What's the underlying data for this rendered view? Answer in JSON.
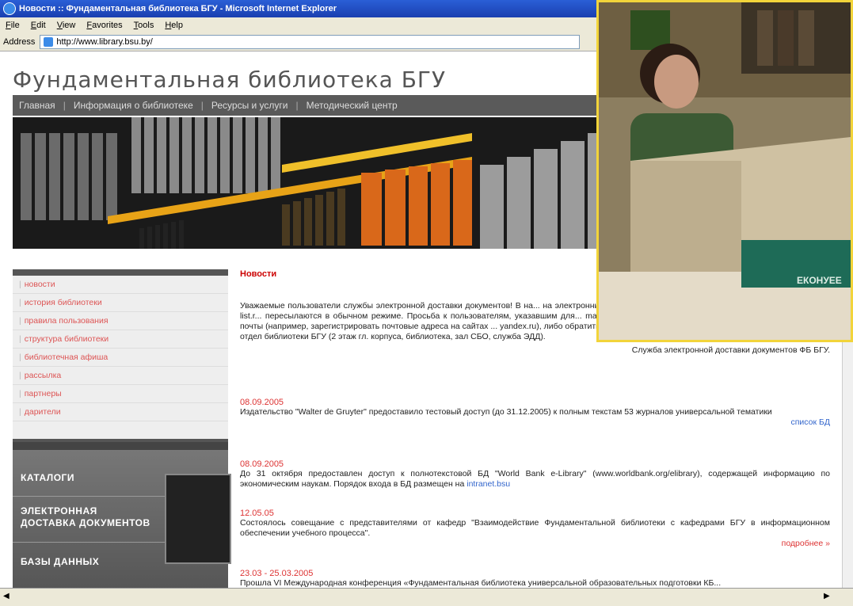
{
  "window": {
    "title": "Новости :: Фундаментальная библиотека БГУ - Microsoft Internet Explorer"
  },
  "menu": [
    "File",
    "Edit",
    "View",
    "Favorites",
    "Tools",
    "Help"
  ],
  "address": {
    "label": "Address",
    "url": "http://www.library.bsu.by/"
  },
  "site": {
    "title": "Фундаментальная библиотека БГУ",
    "nav": [
      "Главная",
      "Информация о библиотеке",
      "Ресурсы и услуги",
      "Методический центр"
    ]
  },
  "sidebar": {
    "items": [
      "новости",
      "история библиотеки",
      "правила пользования",
      "структура библиотеки",
      "библиотечная афиша",
      "рассылка",
      "партнеры",
      "дарители"
    ]
  },
  "promo": {
    "catalogs": "КАТАЛОГИ",
    "edd_line1": "ЭЛЕКТРОННАЯ",
    "edd_line2": "ДОСТАВКА ДОКУМЕНТОВ",
    "databases": "БАЗЫ ДАННЫХ"
  },
  "news": {
    "heading": "Новости",
    "intro": "Уважаемые пользователи службы электронной доставки документов! В на... на электронные адреса почтового сервера mail.ru (mail.ru; inbox.ru; bk.ru; list.r... пересылаются в обычном режиме. Просьба к пользователям, указавшим для... mail.ru , сообщить в службу ЭДД другие адреса электронной почты (например, зарегистрировать почтовые адреса на сайтах ... yandex.ru), либо обратиться для получения заказов в справочно-библиографический отдел библиотеки БГУ (2 этаж гл. корпуса, библиотека, зал СБО, служба ЭДД).",
    "signature": "Служба электронной доставки документов ФБ БГУ.",
    "items": [
      {
        "date": "08.09.2005",
        "text": "Издательство \"Walter de Gruyter\" предоставило тестовый доступ (до 31.12.2005) к полным текстам 53 журналов универсальной тематики",
        "link": "список БД"
      },
      {
        "date": "08.09.2005",
        "text": "До 31 октября предоставлен доступ к полнотекстовой БД \"World Bank e-Library\" (www.worldbank.org/elibrary), содержащей информацию по экономическим наукам. Порядок входа в БД размещен на",
        "inline_link": "intranet.bsu",
        "link": ""
      },
      {
        "date": "12.05.05",
        "text": "Состоялось совещание с представителями от кафедр \"Взаимодействие Фундаментальной библиотеки с кафедрами БГУ в информационном обеспечении учебного процесса\".",
        "link": "подробнее »"
      },
      {
        "date": "23.03 - 25.03.2005",
        "text": "Прошла VI Международная конференция «Фундаментальная библиотека универсальной образовательных подготовки КБ...",
        "link": ""
      }
    ]
  },
  "photo_sign": "ЕКОНУЕЕ"
}
